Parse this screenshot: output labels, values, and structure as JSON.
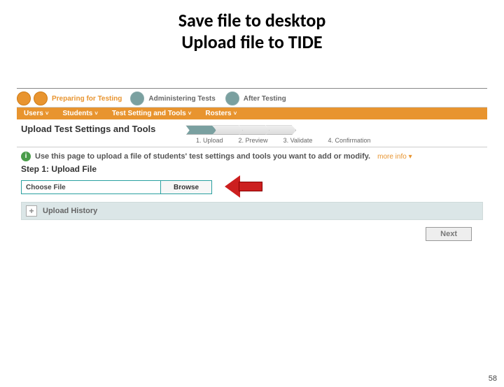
{
  "slide": {
    "title_line1": "Save file to desktop",
    "title_line2": "Upload file to TIDE",
    "page_number": "58"
  },
  "workflow": {
    "ステージ1": "Preparing for Testing",
    "stage2": "Administering Tests",
    "stage3": "After Testing"
  },
  "orange_menu": {
    "users": "Users",
    "students": "Students",
    "test_settings": "Test Setting and Tools",
    "rosters": "Rosters"
  },
  "page_heading": "Upload Test Settings and Tools",
  "steps": {
    "s1": "1. Upload",
    "s2": "2. Preview",
    "s3": "3. Validate",
    "s4": "4. Confirmation"
  },
  "info": {
    "text": "Use this page to upload a file of students' test settings and tools you want to add or modify.",
    "more": "more info"
  },
  "step1_heading": "Step 1: Upload File",
  "file": {
    "choose_label": "Choose File",
    "browse_label": "Browse"
  },
  "history_label": "Upload History",
  "next_label": "Next",
  "icons": {
    "caret": "˅",
    "plus": "+",
    "tri": "▾"
  }
}
